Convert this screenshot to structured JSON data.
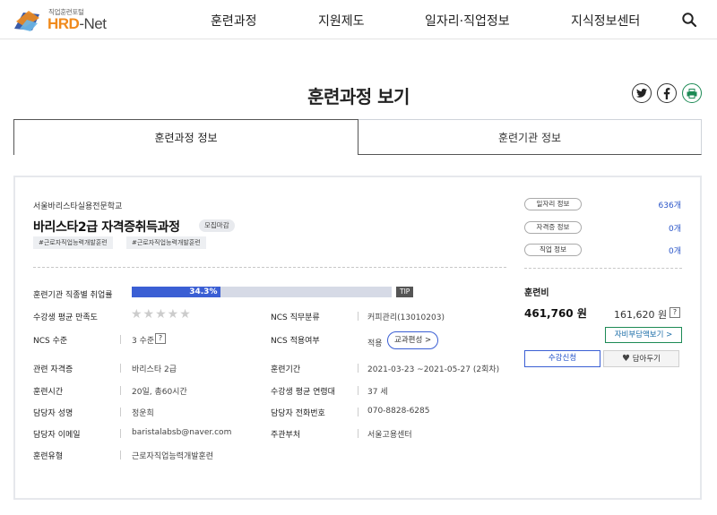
{
  "header": {
    "logo_sub": "직업훈련포털",
    "logo_main_a": "HRD",
    "logo_main_b": "-Net",
    "nav": [
      "훈련과정",
      "지원제도",
      "일자리·직업정보",
      "지식정보센터"
    ]
  },
  "page": {
    "title": "훈련과정 보기"
  },
  "tabs": {
    "active": "훈련과정 정보",
    "inactive": "훈련기관 정보"
  },
  "course": {
    "institution": "서울바리스타실용전문학교",
    "title": "바리스타2급 자격증취득과정",
    "status_badge": "모집마감",
    "tags": [
      "#근로자직업능력개발훈련",
      "#근로자직업능력개발훈련"
    ]
  },
  "details": {
    "employment_rate_label": "훈련기관 직종별 취업률",
    "employment_rate_text": "34.3%",
    "employment_rate_fraction": 0.343,
    "tip": "TIP",
    "satisfaction_label": "수강생 평균 만족도",
    "satisfaction_stars": "★★★★★",
    "ncs_category_label": "NCS 직무분류",
    "ncs_category": "커피관리(13010203)",
    "ncs_level_label": "NCS 수준",
    "ncs_level": "3 수준",
    "ncs_apply_label": "NCS 적용여부",
    "ncs_apply": "적용",
    "curriculum_btn": "교과편성 >",
    "cert_label": "관련 자격증",
    "cert": "바리스타 2급",
    "period_label": "훈련기간",
    "period": "2021-03-23 ~2021-05-27 (2회차)",
    "hours_label": "훈련시간",
    "hours": "20일, 총60시간",
    "age_label": "수강생 평균 연령대",
    "age": "37 세",
    "manager_label": "담당자 성명",
    "manager": "정운희",
    "phone_label": "담당자 전화번호",
    "phone": "070-8828-6285",
    "email_label": "담당자 이메일",
    "email": "baristalabsb@naver.com",
    "dept_label": "주관부처",
    "dept": "서울고용센터",
    "type_label": "훈련유형",
    "type": "근로자직업능력개발훈련",
    "qmark": "?"
  },
  "side": {
    "job_info": "일자리 정보",
    "job_count": "636개",
    "cert_info": "자격증 정보",
    "cert_count": "0개",
    "career_info": "직업 정보",
    "career_count": "0개",
    "fee_label": "훈련비",
    "fee_main": "461,760 원",
    "fee_sub": "161,620 원",
    "self_pay_btn": "자비부담액보기 >",
    "apply_btn": "수강신청",
    "save_btn": "담아두기"
  }
}
